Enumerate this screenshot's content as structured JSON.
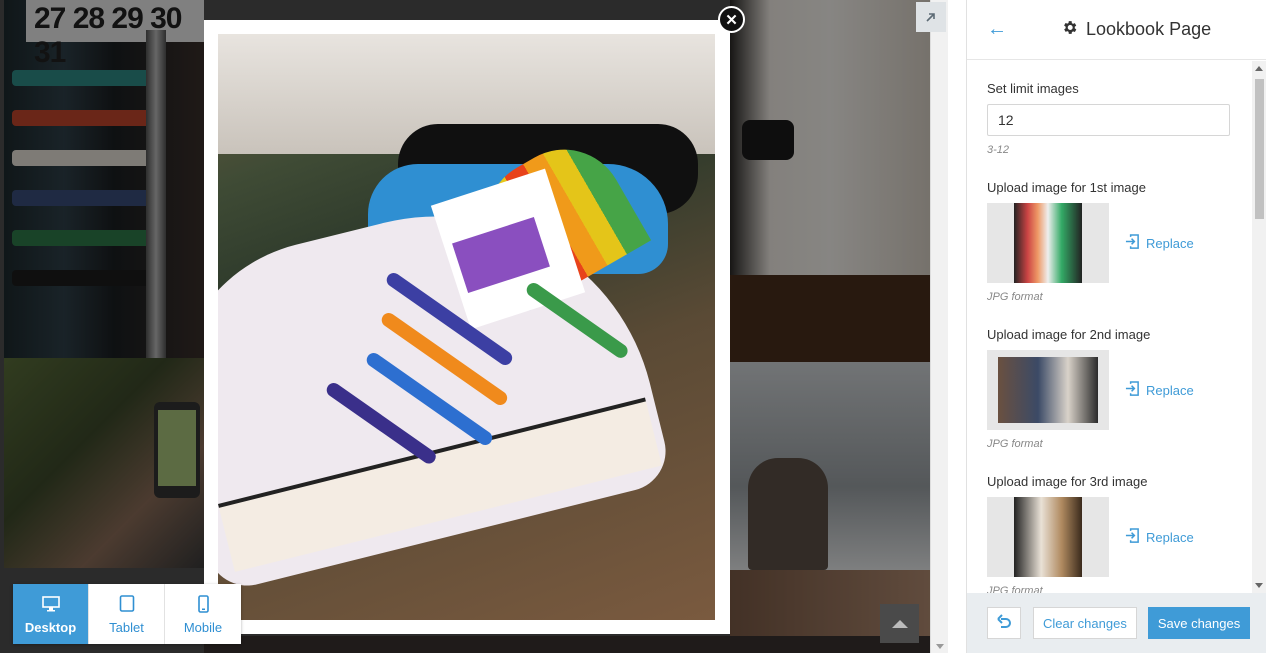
{
  "preview": {
    "background_calendar_text": "27 28 29 30 31",
    "devices": [
      {
        "label": "Desktop",
        "icon": "desktop-icon",
        "active": true
      },
      {
        "label": "Tablet",
        "icon": "tablet-icon",
        "active": false
      },
      {
        "label": "Mobile",
        "icon": "mobile-icon",
        "active": false
      }
    ],
    "lightbox": {
      "close_glyph": "✕",
      "image_subject": "rainbow-laced white sneaker"
    },
    "scroll_top_icon": "chevron-up-icon",
    "expand_icon": "expand-arrow-icon"
  },
  "panel": {
    "back_icon": "←",
    "title": "Lookbook Page",
    "limit": {
      "label": "Set limit images",
      "value": "12",
      "hint": "3-12"
    },
    "images": [
      {
        "label": "Upload image for 1st image",
        "button": "Replace",
        "hint": "JPG format"
      },
      {
        "label": "Upload image for 2nd image",
        "button": "Replace",
        "hint": "JPG format"
      },
      {
        "label": "Upload image for 3rd image",
        "button": "Replace",
        "hint": "JPG format"
      }
    ],
    "footer": {
      "clear_label": "Clear changes",
      "save_label": "Save changes"
    }
  },
  "colors": {
    "accent": "#3f9bd7",
    "footer_bg": "#e9edf0"
  }
}
